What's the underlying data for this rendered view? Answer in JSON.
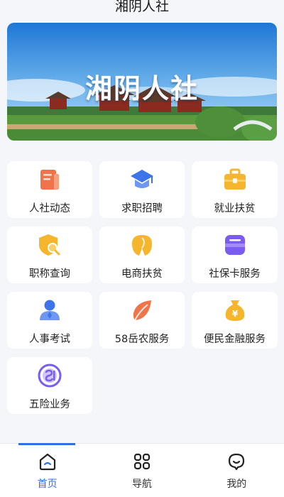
{
  "header": {
    "title": "湘阴人社"
  },
  "banner": {
    "title": "湘阴人社",
    "slides": 3,
    "active_slide": 1
  },
  "services": [
    {
      "label": "人社动态",
      "icon": "news-document-icon",
      "color": "#f0744a"
    },
    {
      "label": "求职招聘",
      "icon": "graduation-cap-icon",
      "color": "#3e74ea"
    },
    {
      "label": "就业扶贫",
      "icon": "briefcase-icon",
      "color": "#f5b52c"
    },
    {
      "label": "职称查询",
      "icon": "shield-search-icon",
      "color": "#f5b52c"
    },
    {
      "label": "电商扶贫",
      "icon": "tooth-leaf-icon",
      "color": "#f5b52c"
    },
    {
      "label": "社保卡服务",
      "icon": "card-icon",
      "color": "#7a5cf0"
    },
    {
      "label": "人事考试",
      "icon": "person-icon",
      "color": "#3e74ea"
    },
    {
      "label": "58岳农服务",
      "icon": "leaf-icon",
      "color": "#f0744a"
    },
    {
      "label": "便民金融服务",
      "icon": "money-bag-icon",
      "color": "#f5b52c"
    },
    {
      "label": "五险业务",
      "icon": "si-logo-icon",
      "color": "#7a5cf0"
    }
  ],
  "tabbar": [
    {
      "label": "首页",
      "icon": "home-icon",
      "active": true
    },
    {
      "label": "导航",
      "icon": "grid-icon",
      "active": false
    },
    {
      "label": "我的",
      "icon": "profile-smile-icon",
      "active": false
    }
  ],
  "colors": {
    "accent": "#2f6fe0",
    "background": "#f4f6fa"
  }
}
